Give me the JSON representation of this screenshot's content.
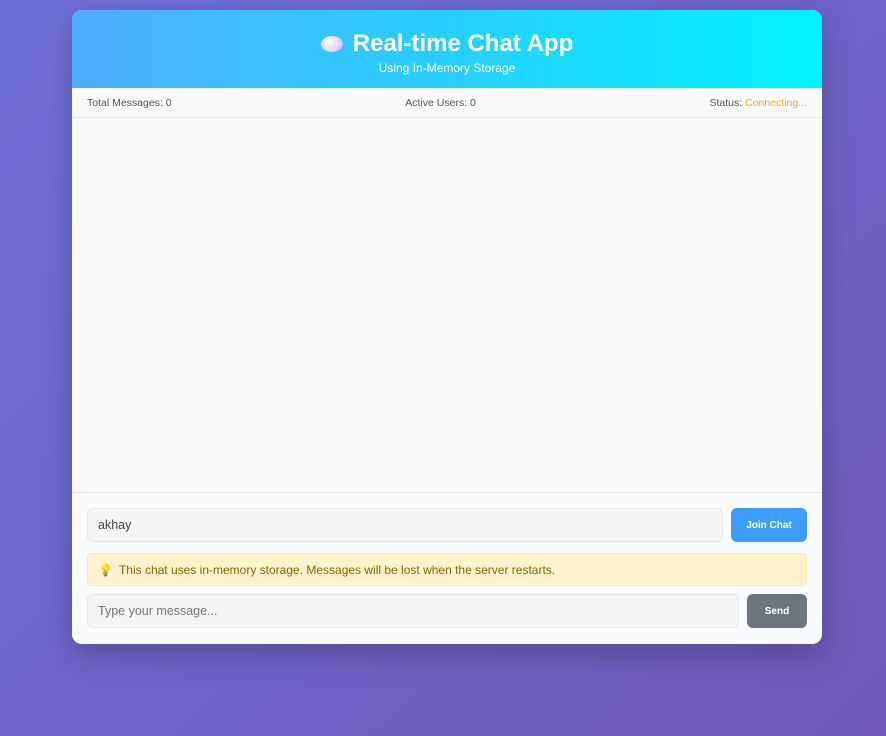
{
  "header": {
    "title": "Real-time Chat App",
    "subtitle": "Using In-Memory Storage",
    "icon": "speech-bubble-icon"
  },
  "stats": {
    "total_messages_label": "Total Messages: 0",
    "active_users_label": "Active Users: 0",
    "status_label": "Status:",
    "status_value": "Connecting...",
    "status_color": "#f0b400"
  },
  "join": {
    "username_value": "akhay",
    "button_label": "Join Chat"
  },
  "notice": {
    "icon": "lightbulb-icon",
    "text": "This chat uses in-memory storage. Messages will be lost when the server restarts."
  },
  "compose": {
    "placeholder": "Type your message...",
    "button_label": "Send"
  }
}
